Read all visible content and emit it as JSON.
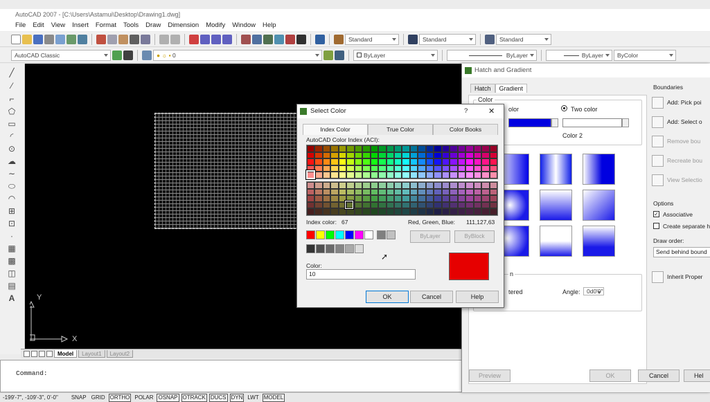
{
  "app": {
    "title": "AutoCAD 2007 - [C:\\Users\\Astamui\\Desktop\\Drawing1.dwg]",
    "menu": [
      "File",
      "Edit",
      "View",
      "Insert",
      "Format",
      "Tools",
      "Draw",
      "Dimension",
      "Modify",
      "Window",
      "Help"
    ]
  },
  "toolbar1": {
    "text_style": "Standard",
    "dim_style": "Standard",
    "table_style": "Standard"
  },
  "toolbar2": {
    "workspace": "AutoCAD Classic",
    "layer": "0",
    "color": "ByLayer",
    "linetype": "ByLayer",
    "lineweight": "ByLayer",
    "plotstyle": "ByColor"
  },
  "layout_tabs": [
    "Model",
    "Layout1",
    "Layout2"
  ],
  "ucs": {
    "x": "X",
    "y": "Y"
  },
  "command": {
    "prompt": "Command:"
  },
  "status": {
    "coords": "-199'-7\", -109'-3\", 0'-0\"",
    "buttons": [
      "SNAP",
      "GRID",
      "ORTHO",
      "POLAR",
      "OSNAP",
      "OTRACK",
      "DUCS",
      "DYN",
      "LWT",
      "MODEL"
    ]
  },
  "hatch_dialog": {
    "title": "Hatch and Gradient",
    "tabs": [
      "Hatch",
      "Gradient"
    ],
    "color_group": "Color",
    "one_color": "olor",
    "two_color": "Two color",
    "color2_label": "Color 2",
    "orientation_partial": "n",
    "centered_partial": "tered",
    "angle_label": "Angle:",
    "angle_value": "0d0'0\"",
    "boundaries_title": "Boundaries",
    "boundaries": [
      "Add: Pick poi",
      "Add: Select o",
      "Remove bou",
      "Recreate bou",
      "View Selectio"
    ],
    "options_title": "Options",
    "associative": "Associative",
    "create_separate": "Create separate h",
    "draw_order_label": "Draw order:",
    "draw_order_value": "Send behind bound",
    "inherit": "Inherit Proper",
    "preview_btn": "Preview",
    "ok_btn": "OK",
    "cancel_btn": "Cancel",
    "help_btn": "Hel"
  },
  "select_color": {
    "title": "Select Color",
    "help_glyph": "?",
    "close_glyph": "✕",
    "tabs": [
      "Index Color",
      "True Color",
      "Color Books"
    ],
    "aci_label": "AutoCAD Color Index (ACI):",
    "index_label": "Index color:",
    "index_value": "67",
    "rgb_label": "Red, Green, Blue:",
    "rgb_value": "111,127,63",
    "bylayer": "ByLayer",
    "byblock": "ByBlock",
    "color_label": "Color:",
    "color_value": "10",
    "selected_color": "#e60000",
    "ok": "OK",
    "cancel": "Cancel",
    "help": "Help"
  }
}
